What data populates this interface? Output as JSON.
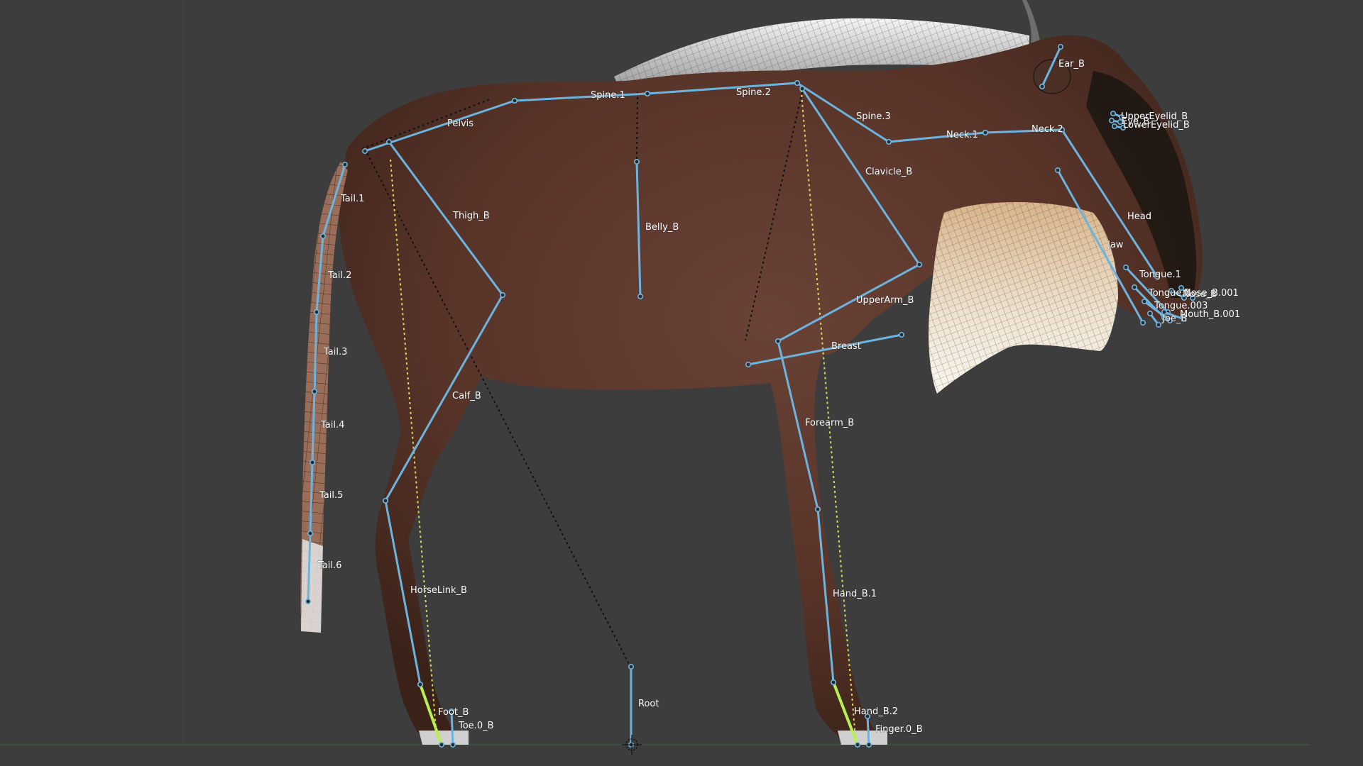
{
  "viewport": {
    "name": "3D Viewport"
  },
  "colors": {
    "background": "#3d3d3d",
    "bone": "#6cb4e0",
    "selected_bone": "#b8f050",
    "ik_line": "#d8d860",
    "relation_line": "#111111",
    "mesh_wire": "#1a1410",
    "hide": "#6b4031"
  },
  "armature": {
    "bones": [
      {
        "id": "spine-1",
        "label": "Spine.1"
      },
      {
        "id": "spine-2",
        "label": "Spine.2"
      },
      {
        "id": "spine-3",
        "label": "Spine.3"
      },
      {
        "id": "pelvis",
        "label": "Pelvis"
      },
      {
        "id": "tail-1",
        "label": "Tail.1"
      },
      {
        "id": "tail-2",
        "label": "Tail.2"
      },
      {
        "id": "tail-3",
        "label": "Tail.3"
      },
      {
        "id": "tail-4",
        "label": "Tail.4"
      },
      {
        "id": "tail-5",
        "label": "Tail.5"
      },
      {
        "id": "tail-6",
        "label": "Tail.6"
      },
      {
        "id": "thigh-b",
        "label": "Thigh_B"
      },
      {
        "id": "calf-b",
        "label": "Calf_B"
      },
      {
        "id": "horselink-b",
        "label": "HorseLink_B"
      },
      {
        "id": "foot-b",
        "label": "Foot_B"
      },
      {
        "id": "toe-b",
        "label": "Toe.0_B"
      },
      {
        "id": "belly-b",
        "label": "Belly_B"
      },
      {
        "id": "root",
        "label": "Root"
      },
      {
        "id": "clavicle-b",
        "label": "Clavicle_B"
      },
      {
        "id": "upperarm-b",
        "label": "UpperArm_B"
      },
      {
        "id": "breast",
        "label": "Breast"
      },
      {
        "id": "forearm-b",
        "label": "Forearm_B"
      },
      {
        "id": "hand-b-1",
        "label": "Hand_B.1"
      },
      {
        "id": "hand-b-2",
        "label": "Hand_B.2"
      },
      {
        "id": "finger-b",
        "label": "Finger.0_B"
      },
      {
        "id": "neck-1",
        "label": "Neck.1"
      },
      {
        "id": "neck-2",
        "label": "Neck.2"
      },
      {
        "id": "head",
        "label": "Head"
      },
      {
        "id": "ear-b",
        "label": "Ear_B"
      },
      {
        "id": "uppereyelid-b",
        "label": "UpperEyelid_B"
      },
      {
        "id": "eye-b",
        "label": "Eye_B"
      },
      {
        "id": "lowereyelid-b",
        "label": "LowerEyelid_B"
      },
      {
        "id": "jaw",
        "label": "Jaw"
      },
      {
        "id": "tongue-1",
        "label": "Tongue.1"
      },
      {
        "id": "tongue-2",
        "label": "Tongue.2"
      },
      {
        "id": "tongue-3",
        "label": "Tongue.003"
      },
      {
        "id": "nose-b",
        "label": "Nose_B"
      },
      {
        "id": "nose-b-001",
        "label": "Nose_B.001"
      },
      {
        "id": "mouth-b-001",
        "label": "Mouth_B.001"
      },
      {
        "id": "joe-b",
        "label": "Joe_B"
      }
    ]
  }
}
